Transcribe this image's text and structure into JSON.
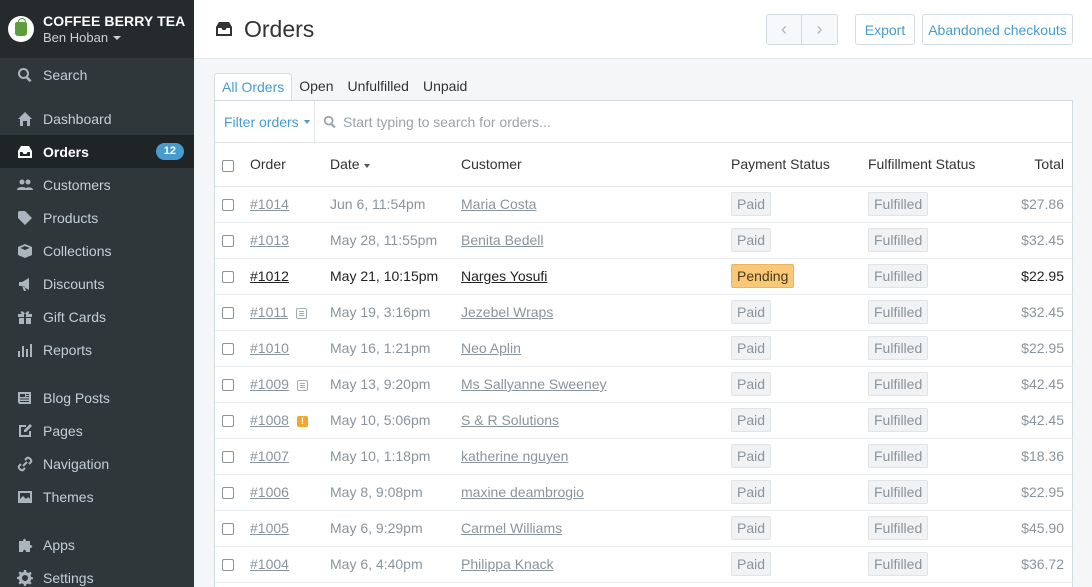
{
  "store": {
    "name": "COFFEE BERRY TEA",
    "user": "Ben Hoban"
  },
  "sidebar": {
    "search_label": "Search",
    "items": [
      {
        "label": "Dashboard",
        "icon": "home-icon"
      },
      {
        "label": "Orders",
        "icon": "inbox-icon",
        "badge": "12",
        "active": true
      },
      {
        "label": "Customers",
        "icon": "users-icon"
      },
      {
        "label": "Products",
        "icon": "tag-icon"
      },
      {
        "label": "Collections",
        "icon": "box-icon"
      },
      {
        "label": "Discounts",
        "icon": "megaphone-icon"
      },
      {
        "label": "Gift Cards",
        "icon": "gift-icon"
      },
      {
        "label": "Reports",
        "icon": "bar-chart-icon"
      },
      {
        "label": "Blog Posts",
        "icon": "newspaper-icon"
      },
      {
        "label": "Pages",
        "icon": "pencil-icon"
      },
      {
        "label": "Navigation",
        "icon": "link-icon"
      },
      {
        "label": "Themes",
        "icon": "image-icon"
      },
      {
        "label": "Apps",
        "icon": "puzzle-icon"
      },
      {
        "label": "Settings",
        "icon": "gear-icon"
      }
    ]
  },
  "header": {
    "title": "Orders",
    "prev_symbol": "‹",
    "next_symbol": "›",
    "export_label": "Export",
    "abandoned_label": "Abandoned checkouts"
  },
  "tabs": [
    "All Orders",
    "Open",
    "Unfulfilled",
    "Unpaid"
  ],
  "filter": {
    "button_label": "Filter orders",
    "search_placeholder": "Start typing to search for orders..."
  },
  "table": {
    "columns": [
      "Order",
      "Date",
      "Customer",
      "Payment Status",
      "Fulfillment Status",
      "Total"
    ],
    "rows": [
      {
        "order": "#1014",
        "date": "Jun 6, 11:54pm",
        "customer": "Maria Costa",
        "payment": "Paid",
        "fulfillment": "Fulfilled",
        "total": "$27.86"
      },
      {
        "order": "#1013",
        "date": "May 28, 11:55pm",
        "customer": "Benita Bedell",
        "payment": "Paid",
        "fulfillment": "Fulfilled",
        "total": "$32.45"
      },
      {
        "order": "#1012",
        "date": "May 21, 10:15pm",
        "customer": "Narges Yosufi",
        "payment": "Pending",
        "fulfillment": "Fulfilled",
        "total": "$22.95",
        "bold": true
      },
      {
        "order": "#1011",
        "date": "May 19, 3:16pm",
        "customer": "Jezebel Wraps",
        "payment": "Paid",
        "fulfillment": "Fulfilled",
        "total": "$32.45",
        "note": true
      },
      {
        "order": "#1010",
        "date": "May 16, 1:21pm",
        "customer": "Neo Aplin",
        "payment": "Paid",
        "fulfillment": "Fulfilled",
        "total": "$22.95"
      },
      {
        "order": "#1009",
        "date": "May 13, 9:20pm",
        "customer": "Ms Sallyanne Sweeney",
        "payment": "Paid",
        "fulfillment": "Fulfilled",
        "total": "$42.45",
        "note": true
      },
      {
        "order": "#1008",
        "date": "May 10, 5:06pm",
        "customer": "S & R Solutions",
        "payment": "Paid",
        "fulfillment": "Fulfilled",
        "total": "$42.45",
        "warning": "!"
      },
      {
        "order": "#1007",
        "date": "May 10, 1:18pm",
        "customer": "katherine nguyen",
        "payment": "Paid",
        "fulfillment": "Fulfilled",
        "total": "$18.36"
      },
      {
        "order": "#1006",
        "date": "May 8, 9:08pm",
        "customer": "maxine deambrogio",
        "payment": "Paid",
        "fulfillment": "Fulfilled",
        "total": "$22.95"
      },
      {
        "order": "#1005",
        "date": "May 6, 9:29pm",
        "customer": "Carmel Williams",
        "payment": "Paid",
        "fulfillment": "Fulfilled",
        "total": "$45.90"
      },
      {
        "order": "#1004",
        "date": "May 6, 4:40pm",
        "customer": "Philippa Knack",
        "payment": "Paid",
        "fulfillment": "Fulfilled",
        "total": "$36.72"
      }
    ]
  },
  "colors": {
    "sidebar_bg": "#30373b",
    "accent": "#479ccf",
    "pending": "#f8c778"
  }
}
